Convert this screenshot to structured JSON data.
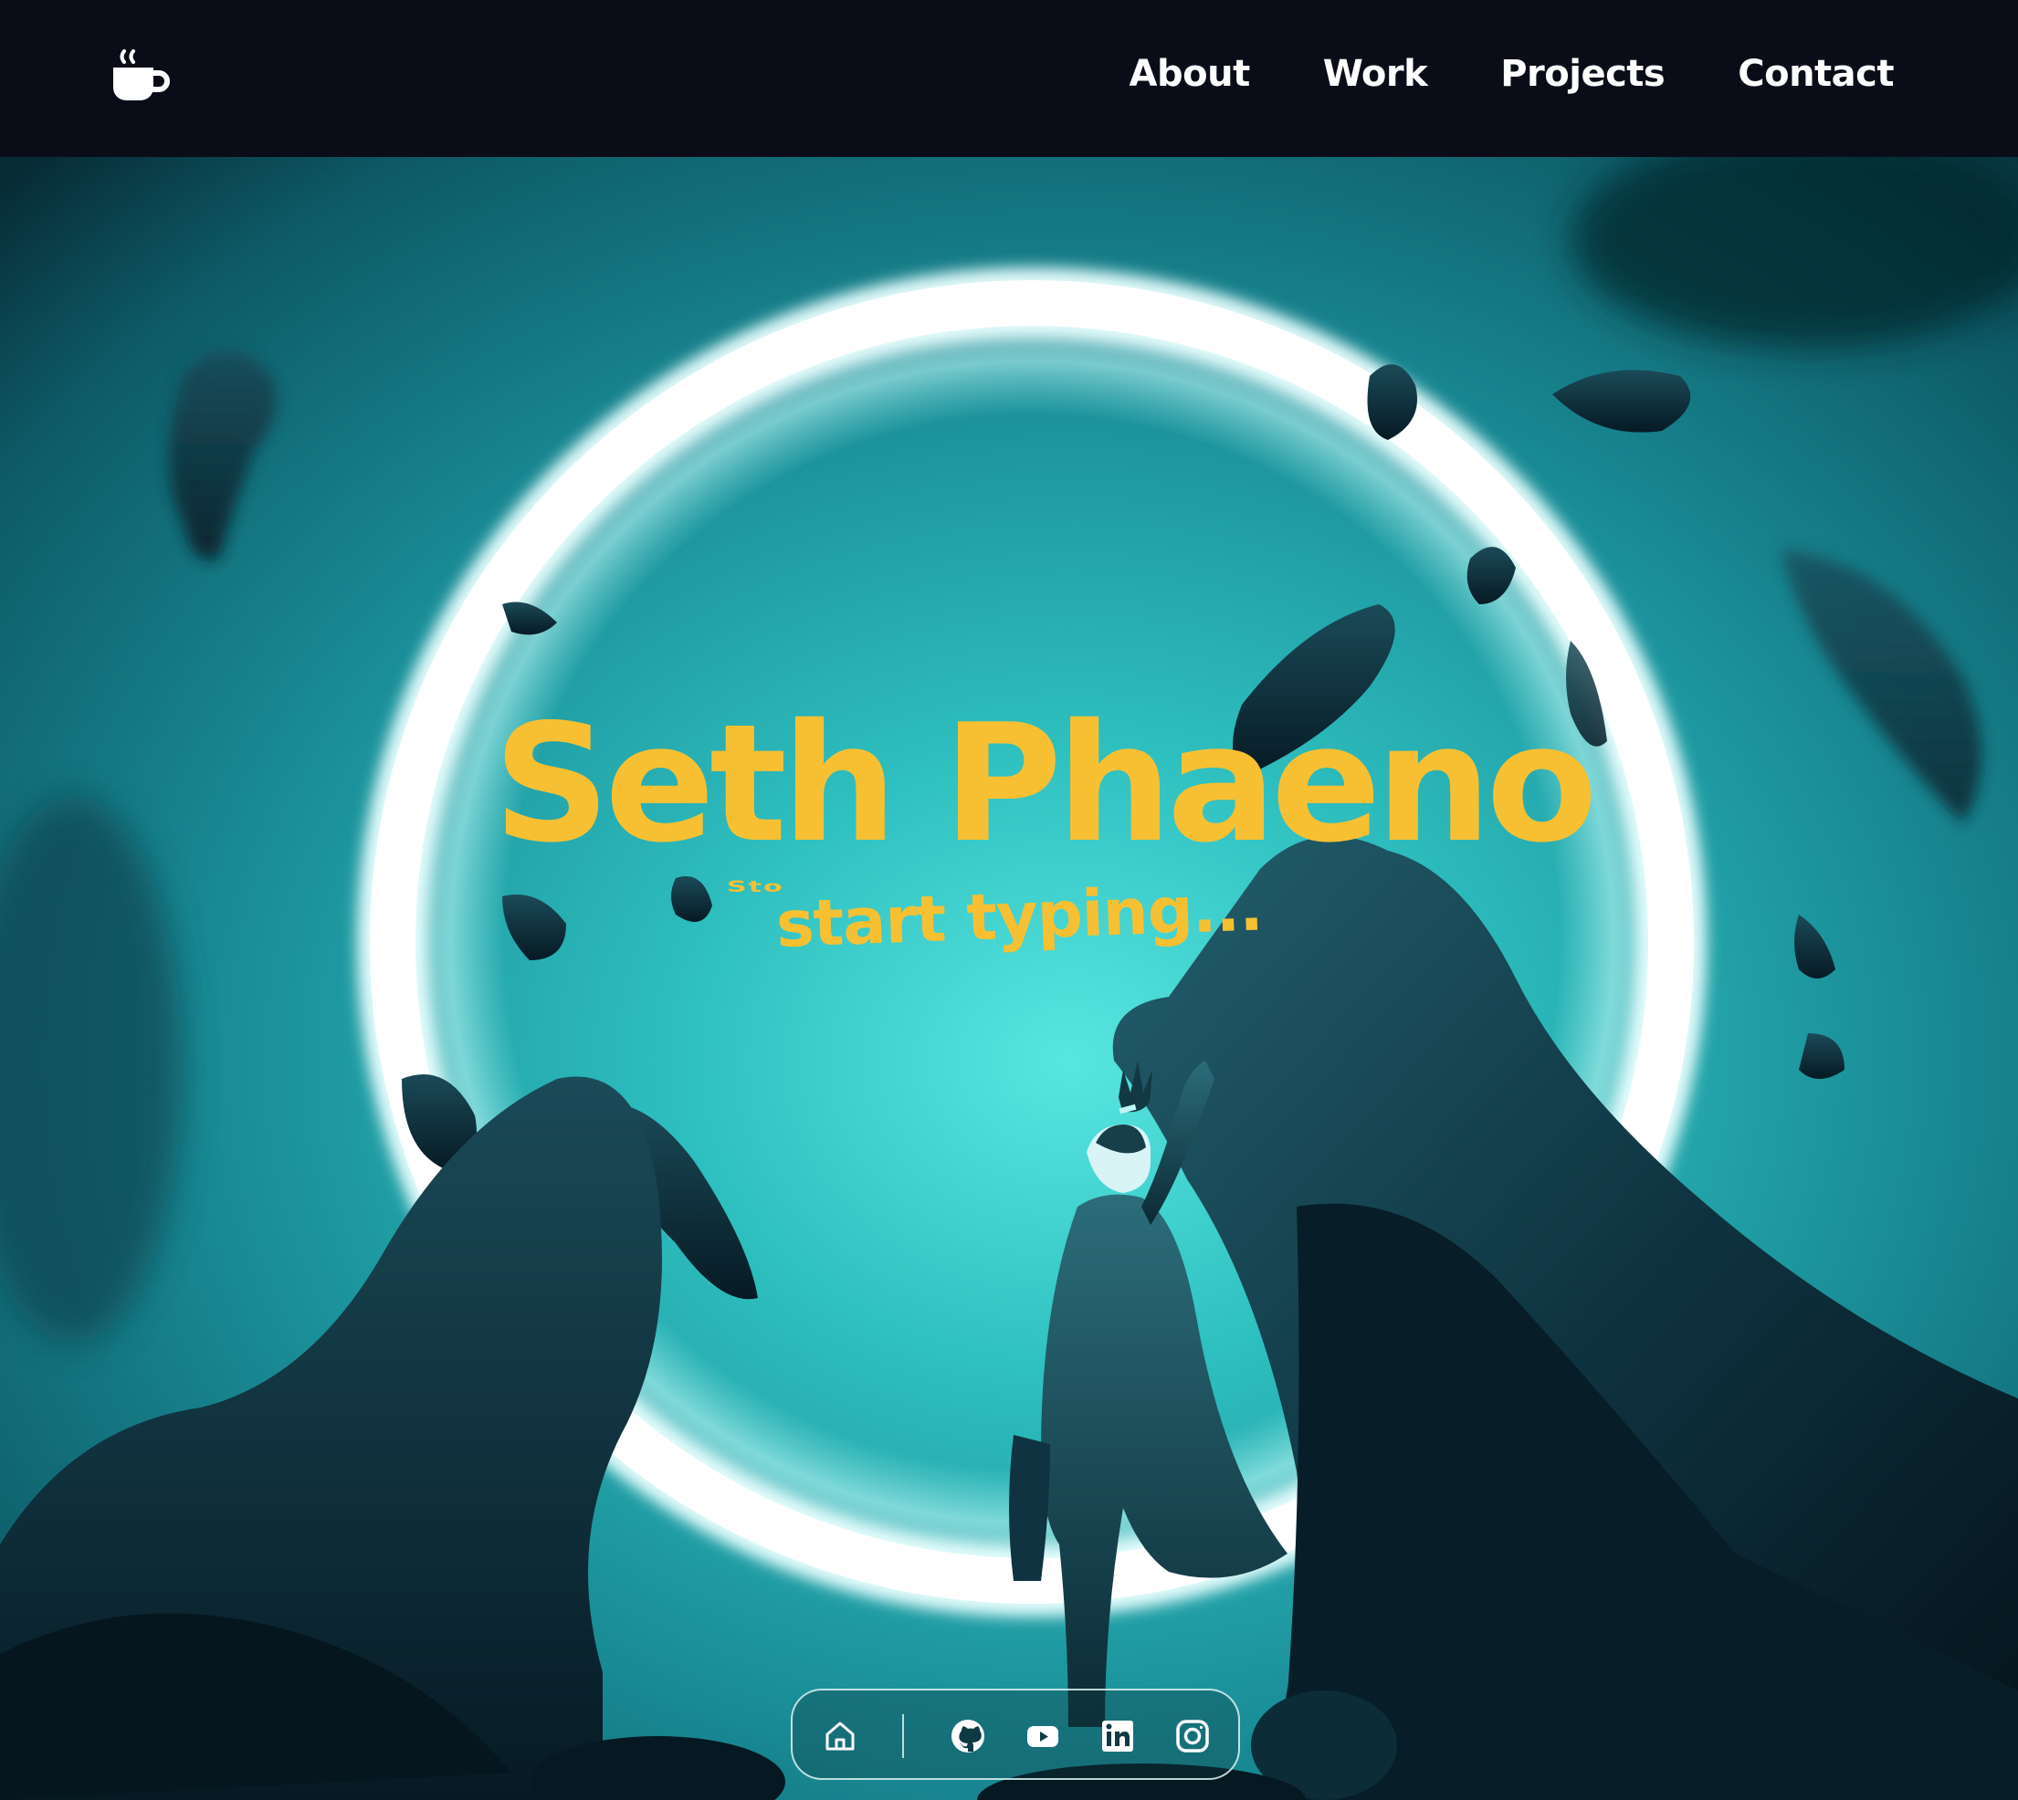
{
  "navbar": {
    "logo_icon": "coffee-cup-icon",
    "links": [
      {
        "label": "About"
      },
      {
        "label": "Work"
      },
      {
        "label": "Projects"
      },
      {
        "label": "Contact"
      }
    ]
  },
  "hero": {
    "title": "Seth Phaeno",
    "ghost_word": "Sto",
    "typing_text": "start typing...",
    "background": "teal-sci-fi-portal-scene",
    "colors": {
      "accent": "#f7c033",
      "navbar": "#0a0d18",
      "scene_teal": "#2fb3b8"
    }
  },
  "dock": {
    "items": [
      {
        "icon": "home-icon"
      },
      {
        "icon": "github-icon"
      },
      {
        "icon": "youtube-icon"
      },
      {
        "icon": "linkedin-icon"
      },
      {
        "icon": "instagram-icon"
      }
    ]
  }
}
